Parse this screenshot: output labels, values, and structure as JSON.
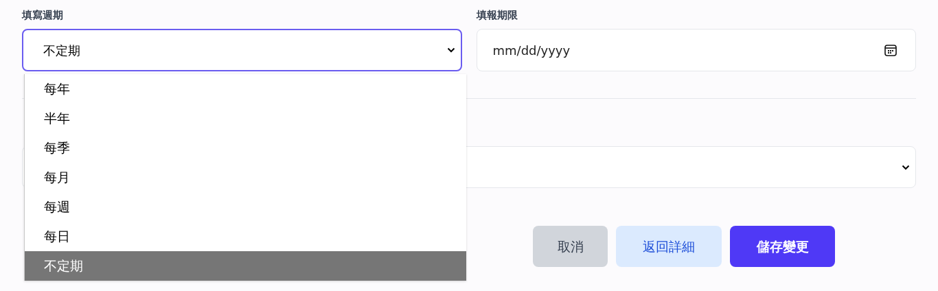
{
  "period_field": {
    "label": "填寫週期",
    "value": "不定期",
    "expanded": true
  },
  "options": [
    {
      "label": "每年",
      "selected": false
    },
    {
      "label": "半年",
      "selected": false
    },
    {
      "label": "每季",
      "selected": false
    },
    {
      "label": "每月",
      "selected": false
    },
    {
      "label": "每週",
      "selected": false
    },
    {
      "label": "每日",
      "selected": false
    },
    {
      "label": "不定期",
      "selected": true
    }
  ],
  "deadline_field": {
    "label": "填報期限",
    "placeholder": "mm/dd/yyyy"
  },
  "buttons": [
    {
      "label": "取消",
      "kind": "cancel"
    },
    {
      "label": "返回詳細",
      "kind": "secondary"
    },
    {
      "label": "儲存變更",
      "kind": "primary"
    }
  ]
}
